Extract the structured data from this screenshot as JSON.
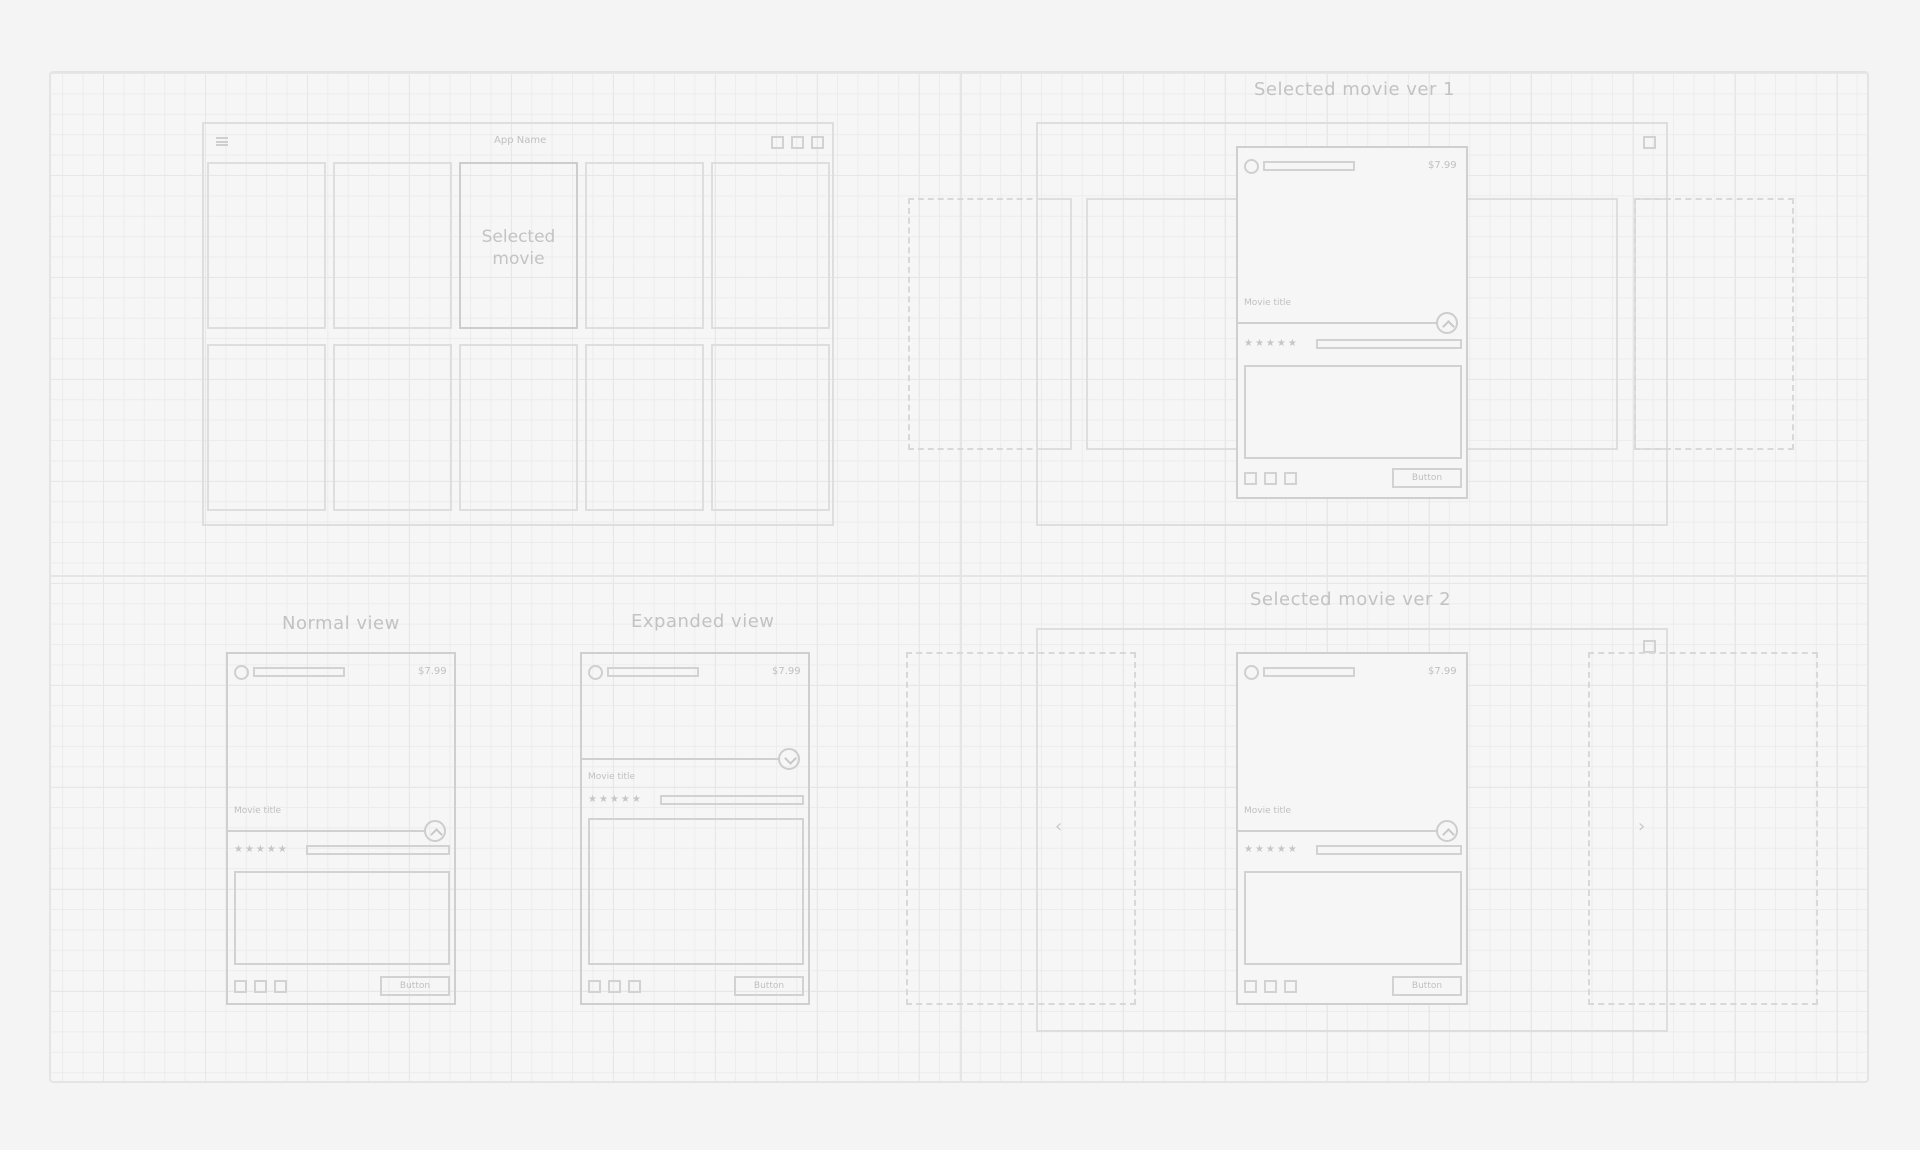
{
  "panels": {
    "grid": {
      "app_name": "App Name",
      "selected_label_line1": "Selected",
      "selected_label_line2": "movie"
    },
    "ver1": {
      "title": "Selected movie ver 1"
    },
    "normal": {
      "title": "Normal view"
    },
    "expanded": {
      "title": "Expanded view"
    },
    "ver2": {
      "title": "Selected movie ver 2"
    }
  },
  "card": {
    "price": "$7.99",
    "movie_title": "Movie title",
    "stars": "★★★★★",
    "button_label": "Button"
  },
  "nav": {
    "prev": "‹",
    "next": "›"
  },
  "icons": {
    "menu": "hamburger-menu-icon",
    "expand": "chevron-up-icon",
    "collapse": "chevron-down-icon"
  }
}
